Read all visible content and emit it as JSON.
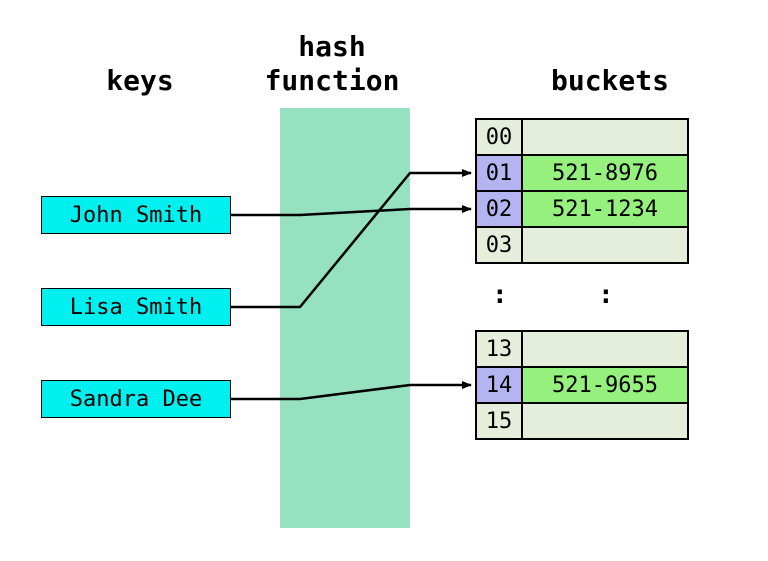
{
  "headings": {
    "keys": "keys",
    "hash_function_line1": "hash",
    "hash_function_line2": "function",
    "buckets": "buckets"
  },
  "keys": [
    {
      "name": "John Smith"
    },
    {
      "name": "Lisa Smith"
    },
    {
      "name": "Sandra Dee"
    }
  ],
  "buckets_top": [
    {
      "index": "00",
      "value": "",
      "hit": false
    },
    {
      "index": "01",
      "value": "521-8976",
      "hit": true
    },
    {
      "index": "02",
      "value": "521-1234",
      "hit": true
    },
    {
      "index": "03",
      "value": "",
      "hit": false
    }
  ],
  "ellipsis": ":",
  "buckets_bottom": [
    {
      "index": "13",
      "value": "",
      "hit": false
    },
    {
      "index": "14",
      "value": "521-9655",
      "hit": true
    },
    {
      "index": "15",
      "value": "",
      "hit": false
    }
  ],
  "mapping_description": "John Smith → bucket 02; Lisa Smith → bucket 01; Sandra Dee → bucket 14",
  "colors": {
    "key_fill": "#00f0f0",
    "hash_fill": "#96e1c0",
    "bucket_empty": "#e4eedb",
    "index_hit": "#b4b4f0",
    "value_hit": "#96f07d"
  }
}
